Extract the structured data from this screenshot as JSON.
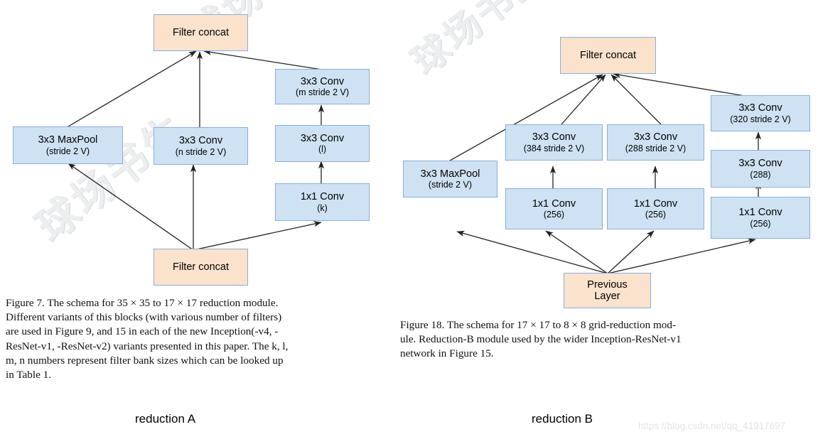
{
  "figure_left": {
    "id": "reduction-a",
    "module_label": "reduction A",
    "nodes": {
      "top_concat": {
        "text": "Filter concat"
      },
      "maxpool": {
        "l1": "3x3 MaxPool",
        "l2": "(stride 2 V)"
      },
      "conv_n": {
        "l1": "3x3 Conv",
        "l2": "(n stride 2 V)"
      },
      "conv_m": {
        "l1": "3x3 Conv",
        "l2": "(m stride 2 V)"
      },
      "conv_l": {
        "l1": "3x3 Conv",
        "l2": "(l)"
      },
      "conv_k": {
        "l1": "1x1 Conv",
        "l2": "(k)"
      },
      "bottom_concat": {
        "text": "Filter concat"
      }
    },
    "caption": {
      "line1": "Figure 7. The schema for 35 × 35 to 17 × 17 reduction module.",
      "line2": "Different variants of this blocks (with various number of filters)",
      "line3": "are used in Figure 9, and 15 in each of the new Inception(-v4, -",
      "line4": "ResNet-v1, -ResNet-v2) variants presented in this paper. The k, l,",
      "line5": "m, n numbers represent filter bank sizes which can be looked up",
      "line6": "in Table 1."
    }
  },
  "figure_right": {
    "id": "reduction-b",
    "module_label": "reduction B",
    "nodes": {
      "top_concat": {
        "text": "Filter concat"
      },
      "maxpool": {
        "l1": "3x3 MaxPool",
        "l2": "(stride 2 V)"
      },
      "conv_384": {
        "l1": "3x3 Conv",
        "l2": "(384 stride 2 V)"
      },
      "conv_288s": {
        "l1": "3x3 Conv",
        "l2": "(288 stride 2 V)"
      },
      "conv_320": {
        "l1": "3x3 Conv",
        "l2": "(320 stride 2 V)"
      },
      "conv_288": {
        "l1": "3x3 Conv",
        "l2": "(288)"
      },
      "conv1x1_a": {
        "l1": "1x1 Conv",
        "l2": "(256)"
      },
      "conv1x1_b": {
        "l1": "1x1 Conv",
        "l2": "(256)"
      },
      "conv1x1_c": {
        "l1": "1x1 Conv",
        "l2": "(256)"
      },
      "previous": {
        "l1": "Previous",
        "l2": "Layer"
      }
    },
    "caption": {
      "line1": "Figure 18. The schema for 17 × 17 to 8 × 8 grid-reduction mod-",
      "line2": "ule. Reduction-B module used by the wider Inception-ResNet-v1",
      "line3": "network in Figure 15."
    }
  },
  "watermarks": {
    "cjk_1": "球场书生",
    "cjk_2": "球场书生",
    "cjk_3": "球场书生",
    "url": "https://blog.csdn.net/qq_41917697"
  },
  "colors": {
    "blue_fill": "#cfe2f3",
    "peach_fill": "#fbe2cc",
    "node_border": "#8aaede",
    "edge": "#222222",
    "background": "#ffffff"
  }
}
